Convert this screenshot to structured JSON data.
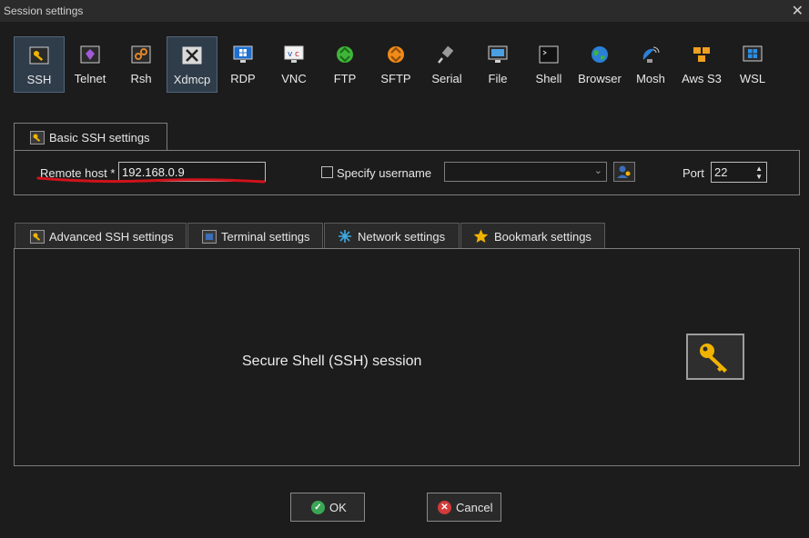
{
  "window": {
    "title": "Session settings"
  },
  "session_types": [
    {
      "label": "SSH",
      "icon": "key-icon",
      "active": true
    },
    {
      "label": "Telnet",
      "icon": "telnet-icon",
      "active": false
    },
    {
      "label": "Rsh",
      "icon": "rsh-icon",
      "active": false
    },
    {
      "label": "Xdmcp",
      "icon": "xdmcp-icon",
      "active": true
    },
    {
      "label": "RDP",
      "icon": "rdp-icon",
      "active": false
    },
    {
      "label": "VNC",
      "icon": "vnc-icon",
      "active": false
    },
    {
      "label": "FTP",
      "icon": "ftp-icon",
      "active": false
    },
    {
      "label": "SFTP",
      "icon": "sftp-icon",
      "active": false
    },
    {
      "label": "Serial",
      "icon": "serial-icon",
      "active": false
    },
    {
      "label": "File",
      "icon": "file-icon",
      "active": false
    },
    {
      "label": "Shell",
      "icon": "shell-icon",
      "active": false
    },
    {
      "label": "Browser",
      "icon": "globe-icon",
      "active": false
    },
    {
      "label": "Mosh",
      "icon": "mosh-icon",
      "active": false
    },
    {
      "label": "Aws S3",
      "icon": "aws-s3-icon",
      "active": false
    },
    {
      "label": "WSL",
      "icon": "wsl-icon",
      "active": false
    }
  ],
  "basic": {
    "tab_label": "Basic SSH settings",
    "remote_host_label": "Remote host *",
    "remote_host_value": "192.168.0.9",
    "specify_username_label": "Specify username",
    "username_value": "",
    "port_label": "Port",
    "port_value": "22"
  },
  "tabs": {
    "advanced": "Advanced SSH settings",
    "terminal": "Terminal settings",
    "network": "Network settings",
    "bookmark": "Bookmark settings"
  },
  "main": {
    "description": "Secure Shell (SSH) session"
  },
  "buttons": {
    "ok": "OK",
    "cancel": "Cancel"
  },
  "colors": {
    "background": "#1c1c1c",
    "accent_red": "#d0121a",
    "ok_green": "#3aa655",
    "cancel_red": "#d43a3a"
  }
}
